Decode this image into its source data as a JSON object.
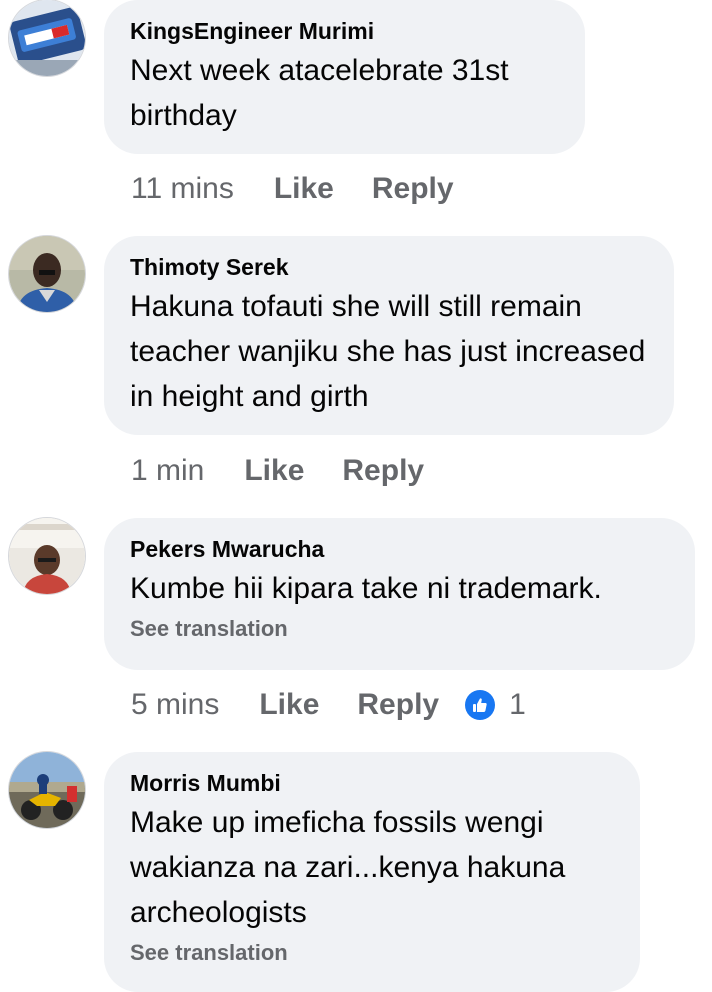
{
  "colors": {
    "bubble": "#f0f2f5",
    "meta_text": "#65676b",
    "like_blue": "#1877f2"
  },
  "comments": [
    {
      "author": "KingsEngineer Murimi",
      "text": "Next week atacelebrate 31st birthday",
      "time": "11 mins",
      "like_label": "Like",
      "reply_label": "Reply",
      "avatar": "tv-logo-avatar"
    },
    {
      "author": "Thimoty Serek",
      "text": "Hakuna tofauti she will still remain teacher wanjiku she has just increased in height and girth",
      "time": "1 min",
      "like_label": "Like",
      "reply_label": "Reply",
      "avatar": "man-portrait-avatar"
    },
    {
      "author": "Pekers Mwarucha",
      "text": "Kumbe hii kipara take  ni trademark.",
      "see_translation": "See translation",
      "time": "5 mins",
      "like_label": "Like",
      "reply_label": "Reply",
      "reaction_icon": "thumbs-up-icon",
      "reaction_count": "1",
      "avatar": "man-indoor-avatar"
    },
    {
      "author": "Morris Mumbi",
      "text": "Make up imeficha fossils wengi wakianza na zari...kenya hakuna archeologists",
      "see_translation": "See translation",
      "avatar": "motorbike-avatar"
    }
  ]
}
